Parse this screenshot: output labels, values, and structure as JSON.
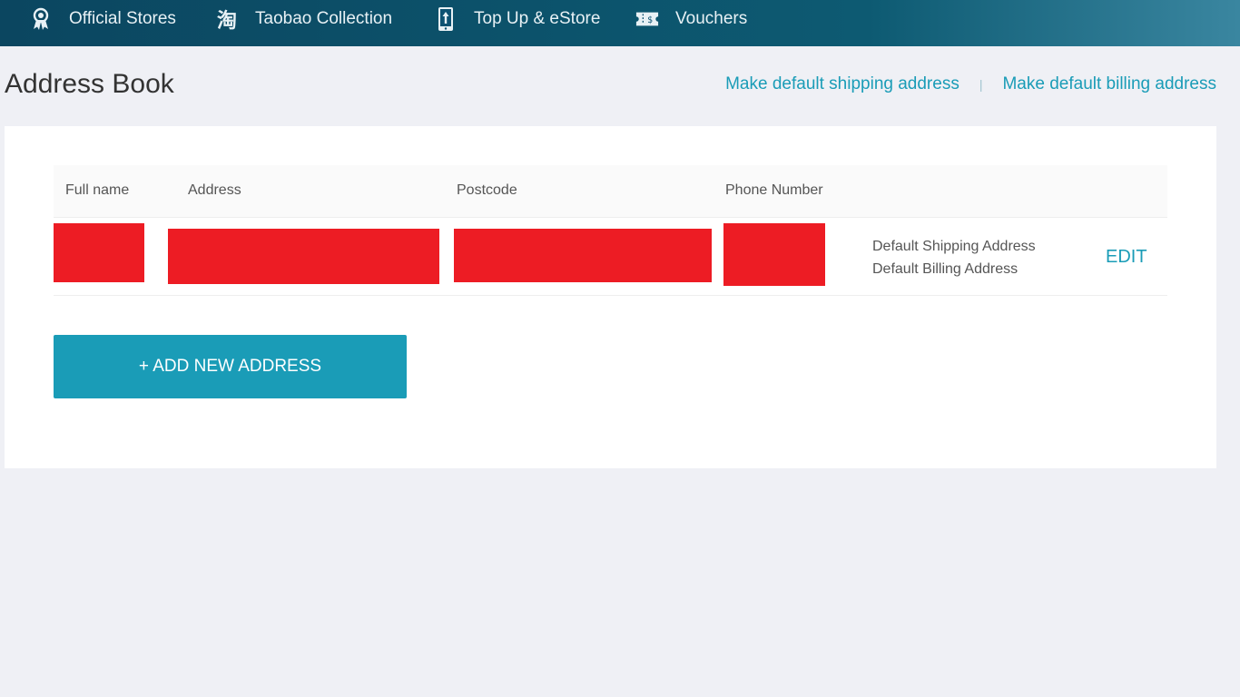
{
  "nav": {
    "items": [
      {
        "icon": "ribbon-badge-icon",
        "label": "Official Stores"
      },
      {
        "icon": "taobao-icon",
        "label": "Taobao Collection"
      },
      {
        "icon": "mobile-topup-icon",
        "label": "Top Up & eStore"
      },
      {
        "icon": "voucher-ticket-icon",
        "label": "Vouchers"
      }
    ],
    "taobao_glyph": "淘"
  },
  "page": {
    "title": "Address Book",
    "make_default_shipping": "Make default shipping address",
    "separator": "|",
    "make_default_billing": "Make default billing address"
  },
  "table": {
    "headers": [
      "Full name",
      "Address",
      "Postcode",
      "Phone Number"
    ],
    "rows": [
      {
        "full_name": "[redacted]",
        "address": "[redacted]",
        "postcode": "[redacted]",
        "phone": "[redacted]",
        "default_shipping": "Default Shipping Address",
        "default_billing": "Default Billing Address",
        "edit_label": "EDIT"
      }
    ]
  },
  "add_button_label": "+ ADD NEW ADDRESS",
  "colors": {
    "accent": "#1a9cb7",
    "nav_bg": "#0d5a72",
    "page_bg": "#eff0f5",
    "redaction": "#ed1c24"
  }
}
